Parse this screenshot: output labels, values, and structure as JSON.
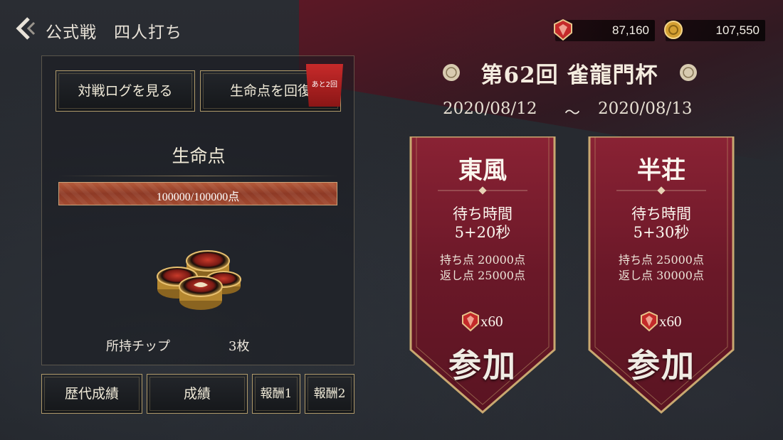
{
  "header": {
    "title": "公式戦　四人打ち",
    "currency_gem": "87,160",
    "currency_coin": "107,550"
  },
  "left_panel": {
    "log_button": "対戦ログを見る",
    "recover_button": "生命点を回復",
    "recover_tag": "あと2回",
    "life_label": "生命点",
    "life_value": "100000/100000点",
    "life_fraction": 1.0,
    "chips_label": "所持チップ",
    "chips_value": "3枚"
  },
  "bottom_buttons": {
    "history": "歴代成績",
    "results": "成績",
    "reward1": "報酬1",
    "reward2": "報酬2"
  },
  "event": {
    "title": "第62回 雀龍門杯",
    "start_date": "2020/08/12",
    "separator": "～",
    "end_date": "2020/08/13"
  },
  "modes": [
    {
      "name": "東風",
      "wait_label": "待ち時間",
      "wait_time": "5+20秒",
      "start_points": "持ち点 20000点",
      "return_points": "返し点 25000点",
      "cost": "x60",
      "join_label": "参加"
    },
    {
      "name": "半荘",
      "wait_label": "待ち時間",
      "wait_time": "5+30秒",
      "start_points": "持ち点 25000点",
      "return_points": "返し点 30000点",
      "cost": "x60",
      "join_label": "参加"
    }
  ],
  "colors": {
    "accent_red": "#7a1a2c",
    "gold_border": "#b09a6a",
    "life_bar": "#a84a30"
  }
}
